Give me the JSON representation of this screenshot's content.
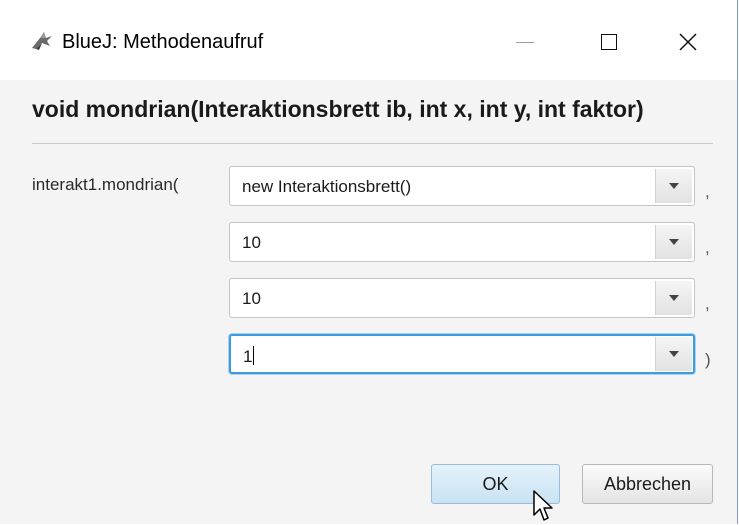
{
  "window": {
    "app_icon": "bluej-bird-icon",
    "title": "BlueJ:  Methodenaufruf",
    "controls": [
      "minimize-icon",
      "maximize-icon",
      "close-icon"
    ]
  },
  "dialog": {
    "signature": "void mondrian(Interaktionsbrett ib, int x, int y, int faktor)",
    "call_prefix": "interakt1.mondrian(",
    "params": [
      {
        "value": "new Interaktionsbrett()",
        "separator": ","
      },
      {
        "value": "10",
        "separator": ","
      },
      {
        "value": "10",
        "separator": ","
      },
      {
        "value": "1",
        "separator": ")"
      }
    ],
    "ok_label": "OK",
    "cancel_label": "Abbrechen"
  },
  "colors": {
    "focus_border": "#3d9be0",
    "default_button": "#c9e2f3"
  }
}
